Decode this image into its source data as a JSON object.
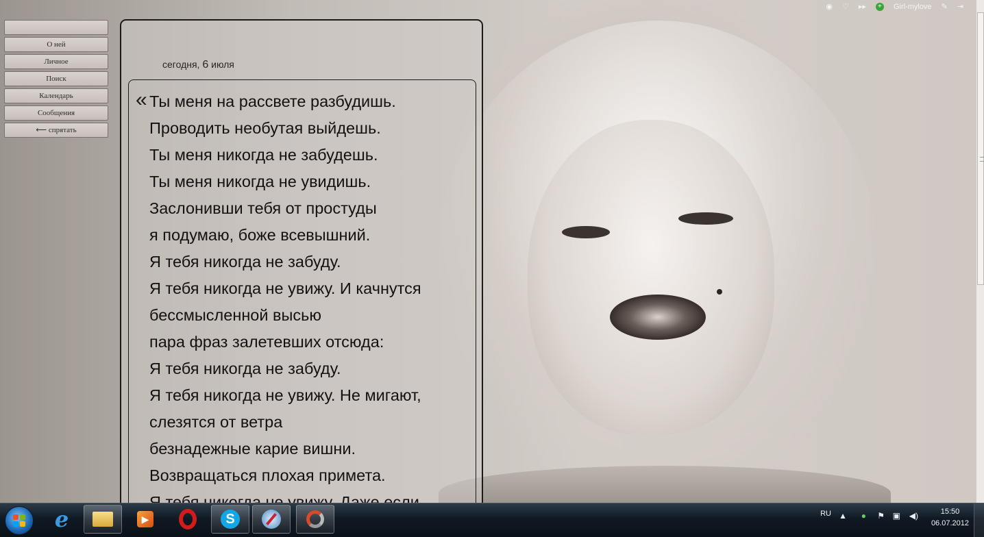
{
  "menu": {
    "items": [
      "",
      "О ней",
      "Личное",
      "Поиск",
      "Календарь",
      "Сообщения",
      "⟵ спрятать"
    ]
  },
  "post": {
    "date_word": "сегодня,",
    "date_num": "6",
    "date_month": "июля",
    "quote_mark": "«",
    "lines": [
      "Ты меня на рассвете разбудишь.",
      "Проводить необутая выйдешь.",
      "Ты меня никогда не забудешь.",
      "Ты меня никогда не увидишь.",
      "Заслонивши тебя от простуды",
      "я подумаю, боже всевышний.",
      "Я тебя никогда не забуду.",
      "Я тебя никогда не увижу. И качнутся",
      "бессмысленной высью",
      "пара фраз залетевших отсюда:",
      "Я тебя никогда не забуду.",
      "Я тебя никогда не увижу. Не мигают,",
      "слезятся от ветра",
      "безнадежные карие вишни.",
      "Возвращаться плохая примета.",
      "Я тебя никогда не увижу. Даже если"
    ]
  },
  "topbar": {
    "username": "Girl-mylove",
    "icons": [
      "rss-icon",
      "heart-icon",
      "forward-icon",
      "add-icon",
      "settings-icon",
      "logout-icon"
    ]
  },
  "taskbar": {
    "apps": [
      "internet-explorer",
      "file-explorer",
      "media-player",
      "opera",
      "skype",
      "safari",
      "app-ring"
    ],
    "tray": {
      "language": "RU",
      "time": "15:50",
      "date": "06.07.2012"
    }
  },
  "colors": {
    "panel_border": "#1c1a19",
    "text": "#141211",
    "taskbar": "#101923"
  }
}
